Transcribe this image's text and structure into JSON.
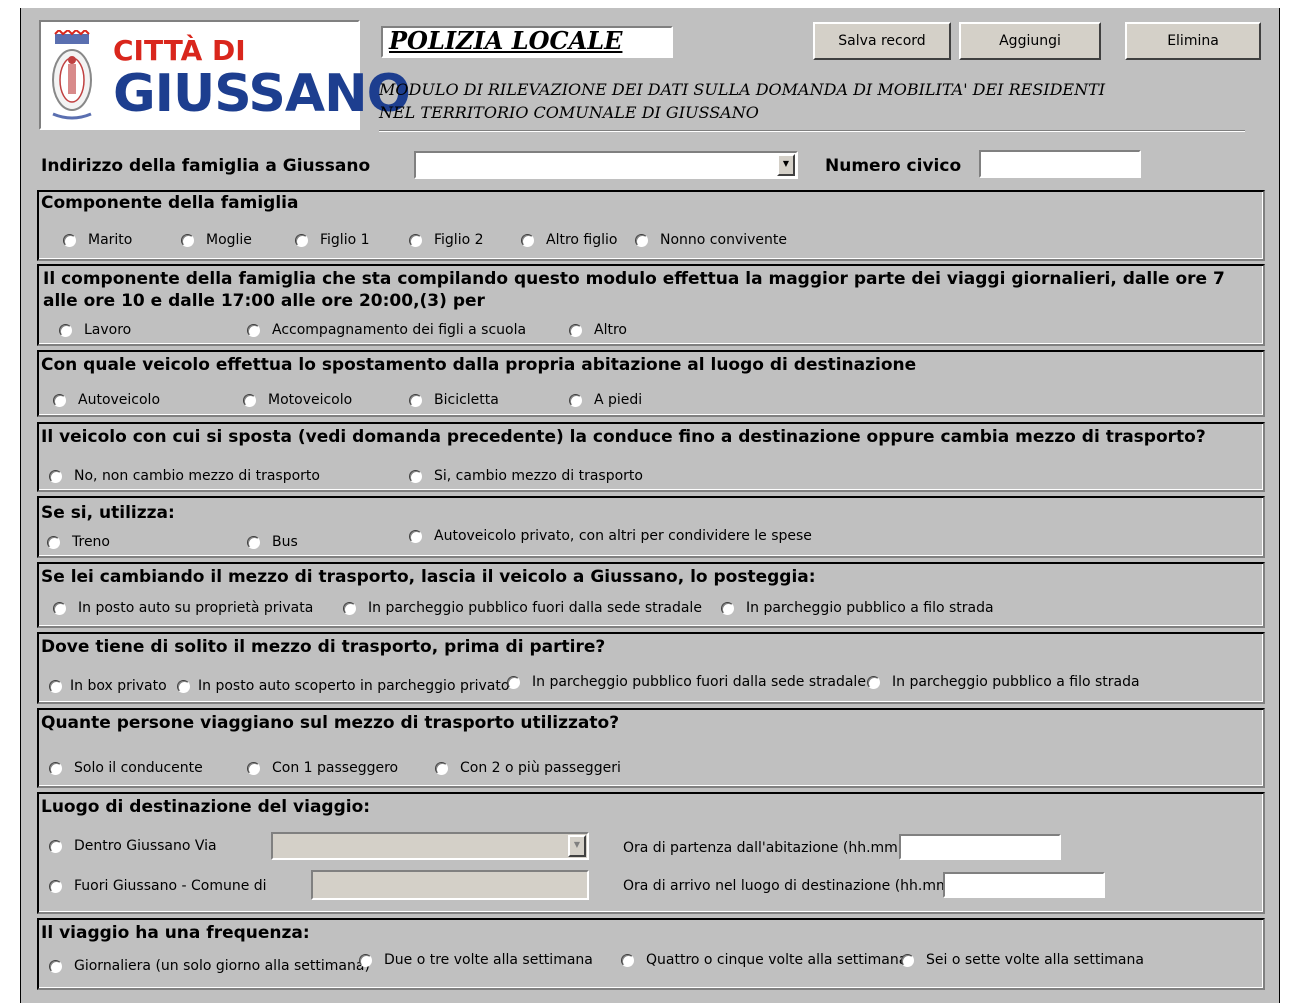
{
  "header": {
    "logo_line1": "CITTÀ DI",
    "logo_line2": "GIUSSANO",
    "polizia": "POLIZIA LOCALE",
    "subtitle_line1": "MODULO DI  RILEVAZIONE  DEI DATI  SULLA DOMANDA DI MOBILITA' DEI RESIDENTI",
    "subtitle_line2": "NEL TERRITORIO COMUNALE DI GIUSSANO"
  },
  "buttons": {
    "salva": "Salva record",
    "aggiungi": "Aggiungi",
    "elimina": "Elimina"
  },
  "address": {
    "label": "Indirizzo della famiglia a Giussano",
    "value": "",
    "civico_label": "Numero civico",
    "civico_value": ""
  },
  "q1": {
    "title": "Componente della famiglia",
    "options": [
      "Marito",
      "Moglie",
      "Figlio 1",
      "Figlio 2",
      "Altro figlio",
      "Nonno convivente"
    ]
  },
  "q2": {
    "title_line1": "Il componente della famiglia che sta compilando questo modulo effettua la maggior parte dei viaggi giornalieri, dalle ore 7",
    "title_line2": "alle ore 10 e dalle 17:00 alle ore 20:00,(3) per",
    "options": [
      "Lavoro",
      "Accompagnamento dei figli a scuola",
      "Altro"
    ]
  },
  "q3": {
    "title": "Con quale veicolo effettua lo spostamento dalla propria abitazione al luogo di destinazione",
    "options": [
      "Autoveicolo",
      "Motoveicolo",
      "Bicicletta",
      "A piedi"
    ]
  },
  "q4": {
    "title": "Il veicolo con cui si sposta (vedi domanda precedente) la conduce fino a destinazione oppure cambia mezzo di trasporto?",
    "options": [
      "No, non cambio mezzo di trasporto",
      "Si, cambio mezzo di trasporto"
    ]
  },
  "q5": {
    "title": "Se si, utilizza:",
    "options": [
      "Treno",
      "Bus",
      "Autoveicolo privato, con altri per condividere le spese"
    ]
  },
  "q6": {
    "title": "Se lei cambiando il mezzo di trasporto,  lascia il veicolo a Giussano, lo posteggia:",
    "options": [
      "In posto auto su proprietà privata",
      "In parcheggio pubblico fuori dalla sede stradale",
      "In parcheggio pubblico a filo strada"
    ]
  },
  "q7": {
    "title": "Dove tiene di solito il mezzo di trasporto, prima di partire?",
    "options": [
      "In box privato",
      "In posto auto scoperto in parcheggio privato",
      "In parcheggio pubblico fuori dalla sede stradale",
      "In parcheggio pubblico a filo strada"
    ]
  },
  "q8": {
    "title": "Quante persone viaggiano sul mezzo di trasporto utilizzato?",
    "options": [
      "Solo il conducente",
      "Con 1 passeggero",
      "Con 2 o più passeggeri"
    ]
  },
  "q9": {
    "title": "Luogo di destinazione del viaggio:",
    "options": [
      "Dentro Giussano Via",
      "Fuori Giussano - Comune di"
    ],
    "partenza_label": "Ora di partenza dall'abitazione (hh.mm)",
    "arrivo_label": "Ora di arrivo nel luogo di destinazione (hh.mm)"
  },
  "q10": {
    "title": "Il viaggio ha una frequenza:",
    "options": [
      "Giornaliera (un solo giorno alla settimana)",
      "Due o tre volte alla settimana",
      "Quattro o cinque volte alla settimana",
      "Sei o sette volte alla settimana"
    ]
  }
}
